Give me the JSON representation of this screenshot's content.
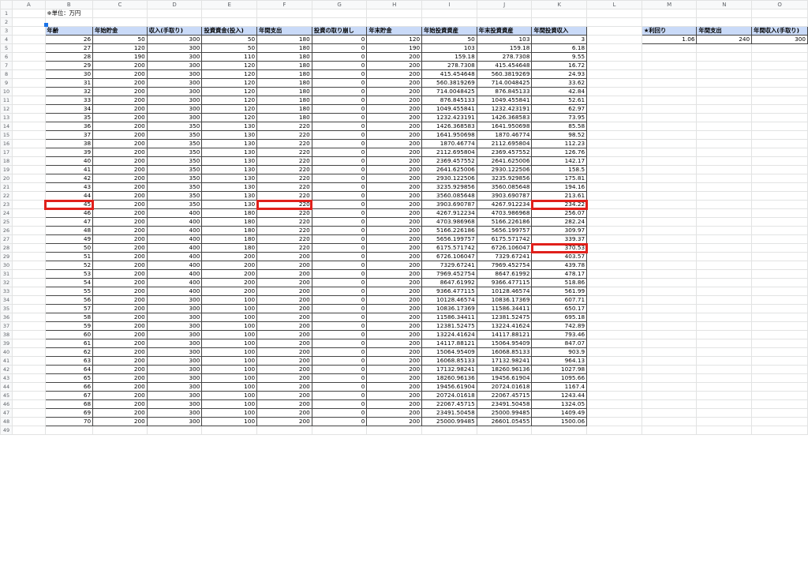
{
  "columns": [
    "",
    "A",
    "B",
    "C",
    "D",
    "E",
    "F",
    "G",
    "H",
    "I",
    "J",
    "K",
    "L",
    "M",
    "N",
    "O"
  ],
  "note": "※単位：万円",
  "headers": [
    "年齢",
    "年始貯金",
    "収入(手取り)",
    "投資資金(投入)",
    "年間支出",
    "投資の取り崩し",
    "年末貯金",
    "年始投資資産",
    "年末投資資産",
    "年間投資収入"
  ],
  "rows": [
    [
      "26",
      "50",
      "300",
      "50",
      "180",
      "0",
      "120",
      "50",
      "103",
      "3"
    ],
    [
      "27",
      "120",
      "300",
      "50",
      "180",
      "0",
      "190",
      "103",
      "159.18",
      "6.18"
    ],
    [
      "28",
      "190",
      "300",
      "110",
      "180",
      "0",
      "200",
      "159.18",
      "278.7308",
      "9.55"
    ],
    [
      "29",
      "200",
      "300",
      "120",
      "180",
      "0",
      "200",
      "278.7308",
      "415.454648",
      "16.72"
    ],
    [
      "30",
      "200",
      "300",
      "120",
      "180",
      "0",
      "200",
      "415.454648",
      "560.3819269",
      "24.93"
    ],
    [
      "31",
      "200",
      "300",
      "120",
      "180",
      "0",
      "200",
      "560.3819269",
      "714.0048425",
      "33.62"
    ],
    [
      "32",
      "200",
      "300",
      "120",
      "180",
      "0",
      "200",
      "714.0048425",
      "876.845133",
      "42.84"
    ],
    [
      "33",
      "200",
      "300",
      "120",
      "180",
      "0",
      "200",
      "876.845133",
      "1049.455841",
      "52.61"
    ],
    [
      "34",
      "200",
      "300",
      "120",
      "180",
      "0",
      "200",
      "1049.455841",
      "1232.423191",
      "62.97"
    ],
    [
      "35",
      "200",
      "300",
      "120",
      "180",
      "0",
      "200",
      "1232.423191",
      "1426.368583",
      "73.95"
    ],
    [
      "36",
      "200",
      "350",
      "130",
      "220",
      "0",
      "200",
      "1426.368583",
      "1641.950698",
      "85.58"
    ],
    [
      "37",
      "200",
      "350",
      "130",
      "220",
      "0",
      "200",
      "1641.950698",
      "1870.46774",
      "98.52"
    ],
    [
      "38",
      "200",
      "350",
      "130",
      "220",
      "0",
      "200",
      "1870.46774",
      "2112.695804",
      "112.23"
    ],
    [
      "39",
      "200",
      "350",
      "130",
      "220",
      "0",
      "200",
      "2112.695804",
      "2369.457552",
      "126.76"
    ],
    [
      "40",
      "200",
      "350",
      "130",
      "220",
      "0",
      "200",
      "2369.457552",
      "2641.625006",
      "142.17"
    ],
    [
      "41",
      "200",
      "350",
      "130",
      "220",
      "0",
      "200",
      "2641.625006",
      "2930.122506",
      "158.5"
    ],
    [
      "42",
      "200",
      "350",
      "130",
      "220",
      "0",
      "200",
      "2930.122506",
      "3235.929856",
      "175.81"
    ],
    [
      "43",
      "200",
      "350",
      "130",
      "220",
      "0",
      "200",
      "3235.929856",
      "3560.085648",
      "194.16"
    ],
    [
      "44",
      "200",
      "350",
      "130",
      "220",
      "0",
      "200",
      "3560.085648",
      "3903.690787",
      "213.61"
    ],
    [
      "45",
      "200",
      "350",
      "130",
      "220",
      "0",
      "200",
      "3903.690787",
      "4267.912234",
      "234.22"
    ],
    [
      "46",
      "200",
      "400",
      "180",
      "220",
      "0",
      "200",
      "4267.912234",
      "4703.986968",
      "256.07"
    ],
    [
      "47",
      "200",
      "400",
      "180",
      "220",
      "0",
      "200",
      "4703.986968",
      "5166.226186",
      "282.24"
    ],
    [
      "48",
      "200",
      "400",
      "180",
      "220",
      "0",
      "200",
      "5166.226186",
      "5656.199757",
      "309.97"
    ],
    [
      "49",
      "200",
      "400",
      "180",
      "220",
      "0",
      "200",
      "5656.199757",
      "6175.571742",
      "339.37"
    ],
    [
      "50",
      "200",
      "400",
      "180",
      "220",
      "0",
      "200",
      "6175.571742",
      "6726.106047",
      "370.53"
    ],
    [
      "51",
      "200",
      "400",
      "200",
      "200",
      "0",
      "200",
      "6726.106047",
      "7329.67241",
      "403.57"
    ],
    [
      "52",
      "200",
      "400",
      "200",
      "200",
      "0",
      "200",
      "7329.67241",
      "7969.452754",
      "439.78"
    ],
    [
      "53",
      "200",
      "400",
      "200",
      "200",
      "0",
      "200",
      "7969.452754",
      "8647.61992",
      "478.17"
    ],
    [
      "54",
      "200",
      "400",
      "200",
      "200",
      "0",
      "200",
      "8647.61992",
      "9366.477115",
      "518.86"
    ],
    [
      "55",
      "200",
      "400",
      "200",
      "200",
      "0",
      "200",
      "9366.477115",
      "10128.46574",
      "561.99"
    ],
    [
      "56",
      "200",
      "300",
      "100",
      "200",
      "0",
      "200",
      "10128.46574",
      "10836.17369",
      "607.71"
    ],
    [
      "57",
      "200",
      "300",
      "100",
      "200",
      "0",
      "200",
      "10836.17369",
      "11586.34411",
      "650.17"
    ],
    [
      "58",
      "200",
      "300",
      "100",
      "200",
      "0",
      "200",
      "11586.34411",
      "12381.52475",
      "695.18"
    ],
    [
      "59",
      "200",
      "300",
      "100",
      "200",
      "0",
      "200",
      "12381.52475",
      "13224.41624",
      "742.89"
    ],
    [
      "60",
      "200",
      "300",
      "100",
      "200",
      "0",
      "200",
      "13224.41624",
      "14117.88121",
      "793.46"
    ],
    [
      "61",
      "200",
      "300",
      "100",
      "200",
      "0",
      "200",
      "14117.88121",
      "15064.95409",
      "847.07"
    ],
    [
      "62",
      "200",
      "300",
      "100",
      "200",
      "0",
      "200",
      "15064.95409",
      "16068.85133",
      "903.9"
    ],
    [
      "63",
      "200",
      "300",
      "100",
      "200",
      "0",
      "200",
      "16068.85133",
      "17132.98241",
      "964.13"
    ],
    [
      "64",
      "200",
      "300",
      "100",
      "200",
      "0",
      "200",
      "17132.98241",
      "18260.96136",
      "1027.98"
    ],
    [
      "65",
      "200",
      "300",
      "100",
      "200",
      "0",
      "200",
      "18260.96136",
      "19456.61904",
      "1095.66"
    ],
    [
      "66",
      "200",
      "300",
      "100",
      "200",
      "0",
      "200",
      "19456.61904",
      "20724.01618",
      "1167.4"
    ],
    [
      "67",
      "200",
      "300",
      "100",
      "200",
      "0",
      "200",
      "20724.01618",
      "22067.45715",
      "1243.44"
    ],
    [
      "68",
      "200",
      "300",
      "100",
      "200",
      "0",
      "200",
      "22067.45715",
      "23491.50458",
      "1324.05"
    ],
    [
      "69",
      "200",
      "300",
      "100",
      "200",
      "0",
      "200",
      "23491.50458",
      "25000.99485",
      "1409.49"
    ],
    [
      "70",
      "200",
      "300",
      "100",
      "200",
      "0",
      "200",
      "25000.99485",
      "26601.05455",
      "1500.06"
    ]
  ],
  "side_headers": [
    "★利回り",
    "年間支出",
    "年間収入(手取り)"
  ],
  "side_values": [
    "1.06",
    "240",
    "300"
  ],
  "highlight_color": "#e0201b",
  "header_color": "#c9daf8"
}
